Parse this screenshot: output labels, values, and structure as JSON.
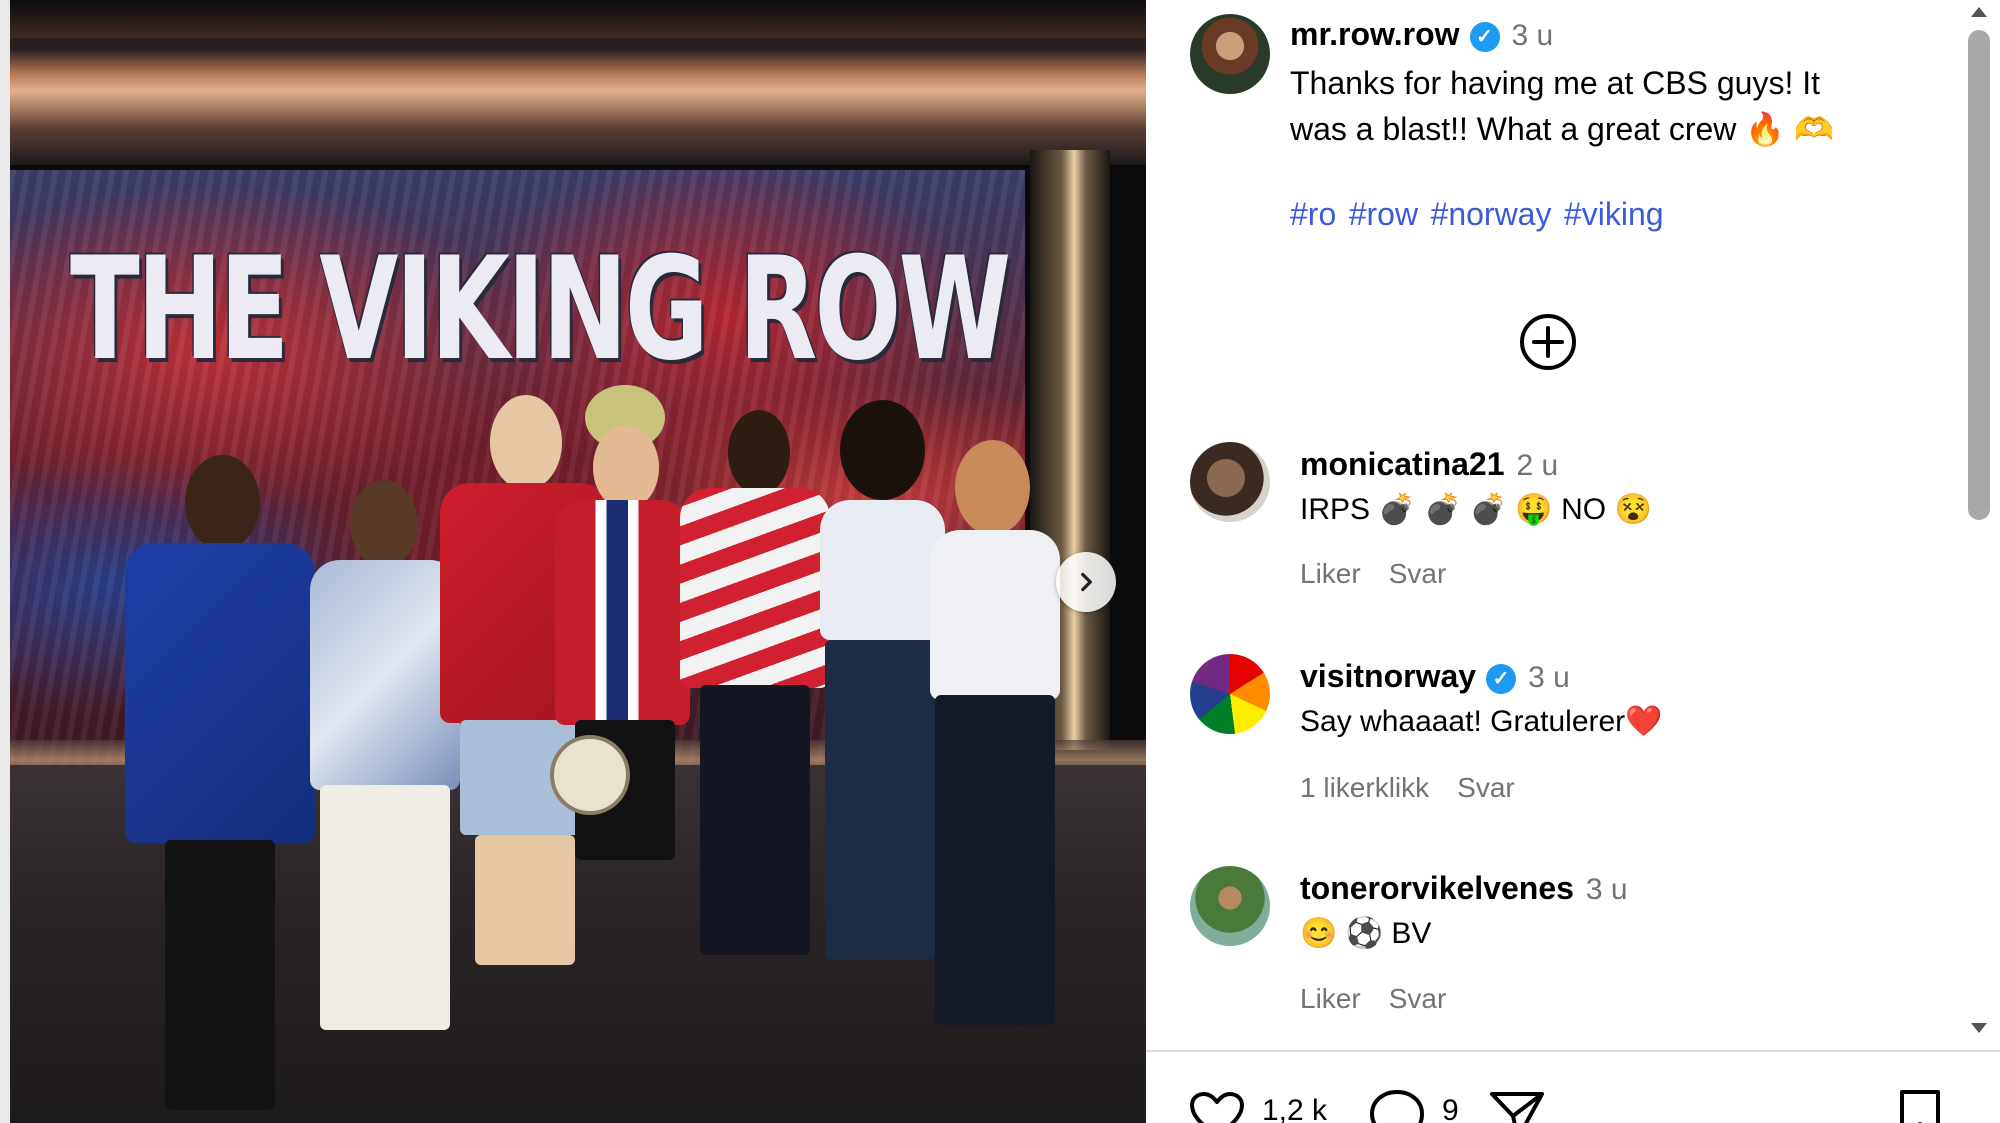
{
  "post": {
    "photo": {
      "screen_title": "THE VIKING ROW",
      "next_button": "chevron-right-icon"
    },
    "author": {
      "username": "mr.row.row",
      "time": "3 u",
      "verified": true
    },
    "caption": {
      "line1": "Thanks for having me at CBS guys! It",
      "line2": "was a blast!! What a great crew",
      "emojis": "🔥 🫶",
      "hashtags": [
        "#ro",
        "#row",
        "#norway",
        "#viking"
      ]
    },
    "add_button_icon": "plus-circle-icon",
    "comments": [
      {
        "username": "monicatina21",
        "time": "2 u",
        "verified": false,
        "text": "IRPS 💣 💣 💣 🤑 NO 😵",
        "meta1": "Liker",
        "meta2": "Svar"
      },
      {
        "username": "visitnorway",
        "time": "3 u",
        "verified": true,
        "text": "Say whaaaat! Gratulerer❤️",
        "meta1": "1 likerklikk",
        "meta2": "Svar"
      },
      {
        "username": "tonerorvikelvenes",
        "time": "3 u",
        "verified": false,
        "text": "😊 ⚽ BV",
        "meta1": "Liker",
        "meta2": "Svar"
      }
    ],
    "footer": {
      "likes": "1,2 k",
      "comments": "9"
    }
  },
  "colors": {
    "hashtag": "#3b5bdb",
    "verified": "#1d9bf0",
    "muted": "#737373"
  }
}
